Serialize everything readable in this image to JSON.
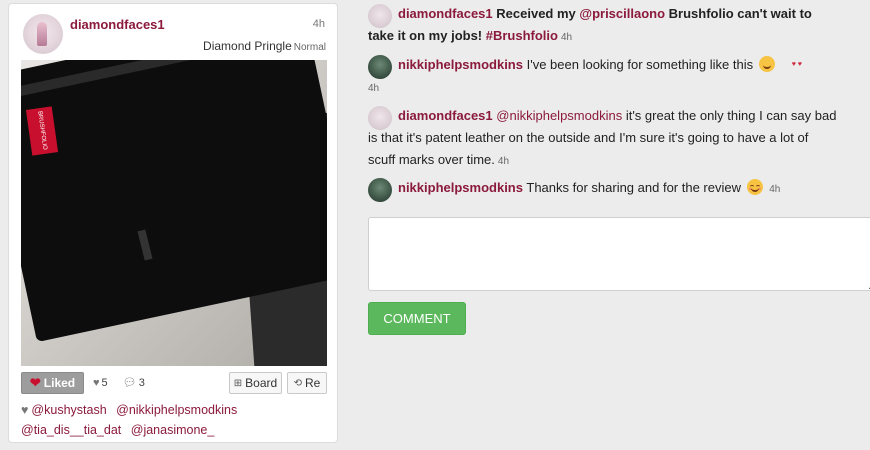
{
  "card": {
    "username": "diamondfaces1",
    "time": "4h",
    "board_name": "Diamond Pringle",
    "board_type": "Normal",
    "photo_label_text": "BRUSHFOLIO",
    "liked_label": "Liked",
    "likes_count": "5",
    "comments_count": "3",
    "board_button": "Board",
    "repin_button": "Re",
    "likers": [
      "@kushystash",
      "@nikkiphelpsmodkins",
      "@tia_dis__tia_dat",
      "@janasimone_"
    ]
  },
  "comments": [
    {
      "user": "diamondfaces1",
      "text_a": "Received my ",
      "mention": "@priscillaono",
      "text_b": " Brushfolio can't wait to take it on my jobs! ",
      "hashtag": "#Brushfolio",
      "time": "4h"
    },
    {
      "user": "nikkiphelpsmodkins",
      "text": "I've been looking for something like this",
      "emoji": "heart-eyes",
      "time": "4h"
    },
    {
      "user": "diamondfaces1",
      "mention": "@nikkiphelpsmodkins",
      "text": " it's great the only thing I can say bad is that it's patent leather on the outside and I'm sure it's going to have a lot of scuff marks over time.",
      "time": "4h"
    },
    {
      "user": "nikkiphelpsmodkins",
      "text": "Thanks for sharing and for the review",
      "emoji": "blush",
      "time": "4h"
    }
  ],
  "comment_input": {
    "value": ""
  },
  "comment_button": "COMMENT",
  "colors": {
    "accent": "#8b1a3c",
    "button_green": "#5cb85c",
    "background": "#ececec"
  }
}
